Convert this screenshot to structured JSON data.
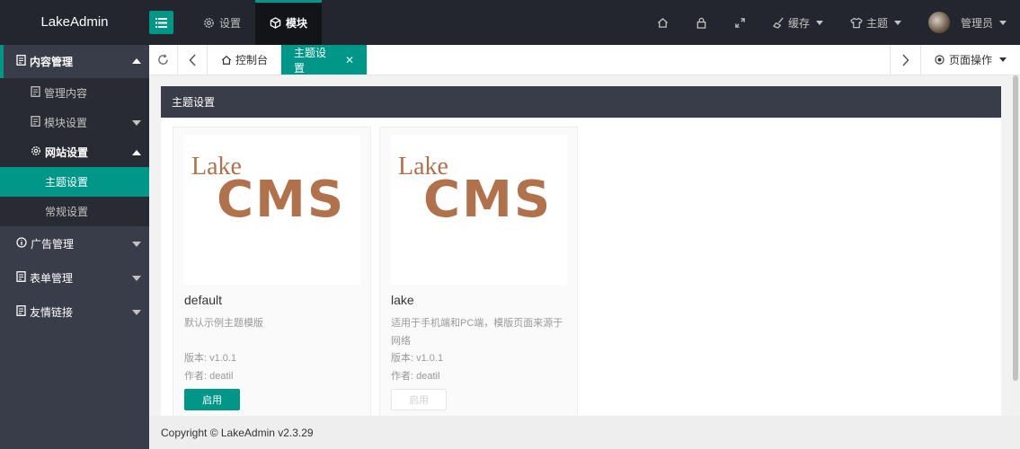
{
  "app": {
    "logo": "LakeAdmin"
  },
  "top_nav": [
    {
      "label": "设置",
      "icon": "gear-icon"
    },
    {
      "label": "模块",
      "icon": "cube-icon"
    }
  ],
  "top_right": {
    "cache": "缓存",
    "theme": "主题",
    "user": "管理员"
  },
  "sidebar": {
    "groups": [
      {
        "label": "内容管理",
        "icon": "doc-icon"
      },
      {
        "label": "广告管理",
        "icon": "info-icon"
      },
      {
        "label": "表单管理",
        "icon": "doc-icon"
      },
      {
        "label": "友情链接",
        "icon": "doc-icon"
      }
    ],
    "content_items": [
      {
        "label": "管理内容"
      },
      {
        "label": "模块设置"
      },
      {
        "label": "网站设置"
      }
    ],
    "site_items": [
      {
        "label": "主题设置"
      },
      {
        "label": "常规设置"
      }
    ]
  },
  "tabs": [
    {
      "label": "控制台"
    },
    {
      "label": "主题设置"
    }
  ],
  "tab_ops": "页面操作",
  "panel": {
    "title": "主题设置",
    "themes": [
      {
        "thumb_top": "Lake",
        "thumb_main": "CMS",
        "name": "default",
        "desc": "默认示例主题模版",
        "version": "版本: v1.0.1",
        "author": "作者: deatil",
        "button": "启用"
      },
      {
        "thumb_top": "Lake",
        "thumb_main": "CMS",
        "name": "lake",
        "desc": "适用于手机端和PC端，模版页面来源于网络",
        "version": "版本: v1.0.1",
        "author": "作者: deatil",
        "button": "启用"
      }
    ]
  },
  "footer": "Copyright © LakeAdmin v2.3.29",
  "colors": {
    "accent": "#009688",
    "header": "#23262e",
    "sidebar": "#393d49",
    "brand_text": "#b0714b"
  }
}
